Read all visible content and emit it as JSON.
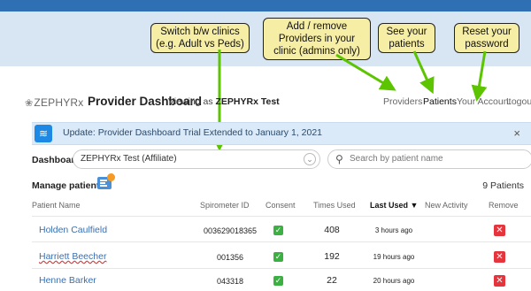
{
  "callouts": {
    "switch_clinics": "Switch b/w clinics (e.g. Adult vs Peds)",
    "add_remove": "Add / remove Providers in your clinic (admins only)",
    "see_patients": "See your patients",
    "reset_password": "Reset your password"
  },
  "header": {
    "logo_text": "ZEPHYRx",
    "title": "Provider Dashboard",
    "viewing_prefix": "Viewing as",
    "viewing_name": "ZEPHYRx Test",
    "nav": [
      "Providers",
      "Patients",
      "Your Account",
      "Logout"
    ],
    "active_nav": "Patients"
  },
  "update": {
    "message": "Update: Provider Dashboard Trial Extended to January 1, 2021",
    "close": "×"
  },
  "dashboard": {
    "label": "Dashboard:",
    "selected": "ZEPHYRx Test (Affiliate)",
    "chevron": "⌄"
  },
  "search": {
    "placeholder": "Search by patient name"
  },
  "manage": {
    "label": "Manage patients:",
    "count": "9 Patients"
  },
  "table": {
    "columns": [
      "Patient Name",
      "Spirometer ID",
      "Consent",
      "Times Used",
      "Last Used ▼",
      "New Activity",
      "Remove"
    ],
    "rows": [
      {
        "name": "Holden Caulfield",
        "spirometer_id": "003629018365",
        "consent": "✓",
        "times_used": "408",
        "last_used": "3 hours ago",
        "new_activity": "",
        "remove": "✕"
      },
      {
        "name": "Harriett Beecher",
        "spirometer_id": "001356",
        "consent": "✓",
        "times_used": "192",
        "last_used": "19 hours ago",
        "new_activity": "",
        "remove": "✕"
      },
      {
        "name": "Henne Barker",
        "spirometer_id": "043318",
        "consent": "✓",
        "times_used": "22",
        "last_used": "20 hours ago",
        "new_activity": "",
        "remove": "✕"
      }
    ]
  },
  "colors": {
    "accent_blue": "#2f6fb3",
    "callout_yellow": "#f7eea6",
    "arrow_green": "#5cc400",
    "remove_red": "#e5343b",
    "consent_green": "#3cb043"
  },
  "icons": {
    "logo": "zephyrx-logo-icon",
    "update": "wind-icon",
    "search": "search-icon",
    "manage": "list-icon"
  }
}
